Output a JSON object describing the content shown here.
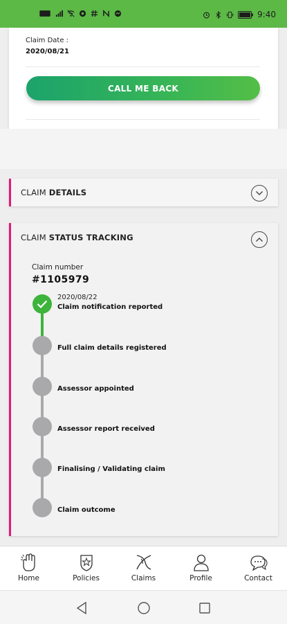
{
  "status_bar": {
    "time": "9:40",
    "left_icons": [
      "network-badge-icon",
      "signal-icon",
      "wifi-off-icon",
      "vpn-icon",
      "hash-icon",
      "nfc-icon",
      "messenger-icon"
    ],
    "right_icons": [
      "alarm-icon",
      "bluetooth-icon",
      "vibrate-icon",
      "battery-icon"
    ],
    "background": "#5cb946"
  },
  "claim": {
    "date_label": "Claim Date :",
    "date_value": "2020/08/21",
    "call_button": "CALL ME BACK"
  },
  "details_card": {
    "title_prefix": "CLAIM",
    "title_bold": "DETAILS",
    "toggle_icon": "chevron-down-icon"
  },
  "tracking_card": {
    "title_prefix": "CLAIM",
    "title_bold": "STATUS TRACKING",
    "toggle_icon": "chevron-up-icon",
    "claim_number_label": "Claim number",
    "claim_number": "#1105979",
    "steps": [
      {
        "date": "2020/08/22",
        "label": "Claim notification reported",
        "done": true
      },
      {
        "date": "",
        "label": "Full claim details registered",
        "done": false
      },
      {
        "date": "",
        "label": "Assessor appointed",
        "done": false
      },
      {
        "date": "",
        "label": "Assessor report received",
        "done": false
      },
      {
        "date": "",
        "label": "Finalising / Validating claim",
        "done": false
      },
      {
        "date": "",
        "label": "Claim outcome",
        "done": false
      }
    ]
  },
  "bottom_nav": {
    "items": [
      {
        "label": "Home",
        "icon": "hand-wave-icon"
      },
      {
        "label": "Policies",
        "icon": "policies-icon"
      },
      {
        "label": "Claims",
        "icon": "claims-icon"
      },
      {
        "label": "Profile",
        "icon": "profile-icon"
      },
      {
        "label": "Contact",
        "icon": "chat-icon"
      }
    ]
  },
  "system_nav": {
    "buttons": [
      "back-icon",
      "home-circle-icon",
      "recents-icon"
    ]
  },
  "colors": {
    "accent_pink": "#e2197a",
    "green": "#3db43b",
    "grey_step": "#a9a9ab"
  }
}
